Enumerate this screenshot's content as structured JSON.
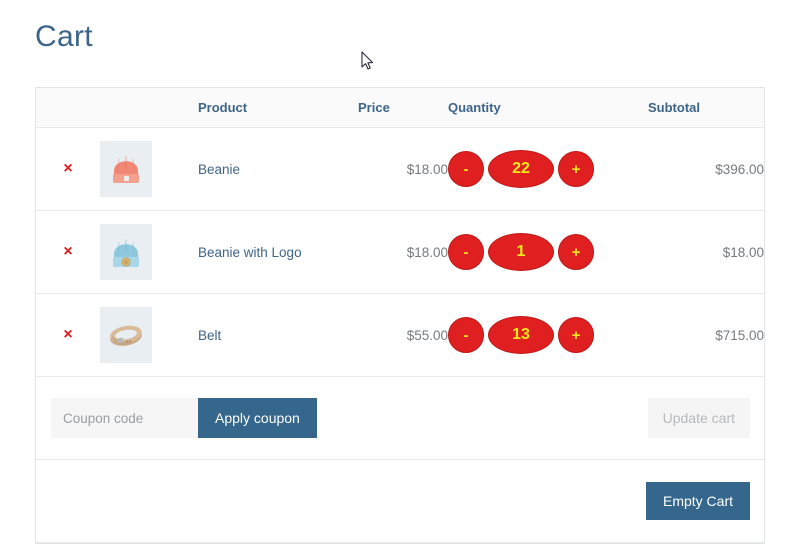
{
  "page": {
    "title": "Cart"
  },
  "table": {
    "headers": {
      "remove": "",
      "thumbnail": "",
      "product": "Product",
      "price": "Price",
      "quantity": "Quantity",
      "subtotal": "Subtotal"
    },
    "rows": [
      {
        "remove_label": "×",
        "thumb_icon": "beanie-coral-image",
        "name": "Beanie",
        "price": "$18.00",
        "qty_decrement": "-",
        "qty_value": "22",
        "qty_increment": "+",
        "subtotal": "$396.00"
      },
      {
        "remove_label": "×",
        "thumb_icon": "beanie-blue-logo-image",
        "name": "Beanie with Logo",
        "price": "$18.00",
        "qty_decrement": "-",
        "qty_value": "1",
        "qty_increment": "+",
        "subtotal": "$18.00"
      },
      {
        "remove_label": "×",
        "thumb_icon": "belt-image",
        "name": "Belt",
        "price": "$55.00",
        "qty_decrement": "-",
        "qty_value": "13",
        "qty_increment": "+",
        "subtotal": "$715.00"
      }
    ]
  },
  "coupon": {
    "placeholder": "Coupon code",
    "value": "",
    "apply_label": "Apply coupon",
    "update_label": "Update cart"
  },
  "actions": {
    "empty_cart_label": "Empty Cart"
  },
  "colors": {
    "accent_blue": "#35678d",
    "heading_blue": "#3d6489",
    "qty_red": "#e02020",
    "qty_yellow": "#ffe81a",
    "remove_red": "#e01b1b",
    "thumb_bg": "#e8eef1",
    "border": "#e8e9ea"
  }
}
